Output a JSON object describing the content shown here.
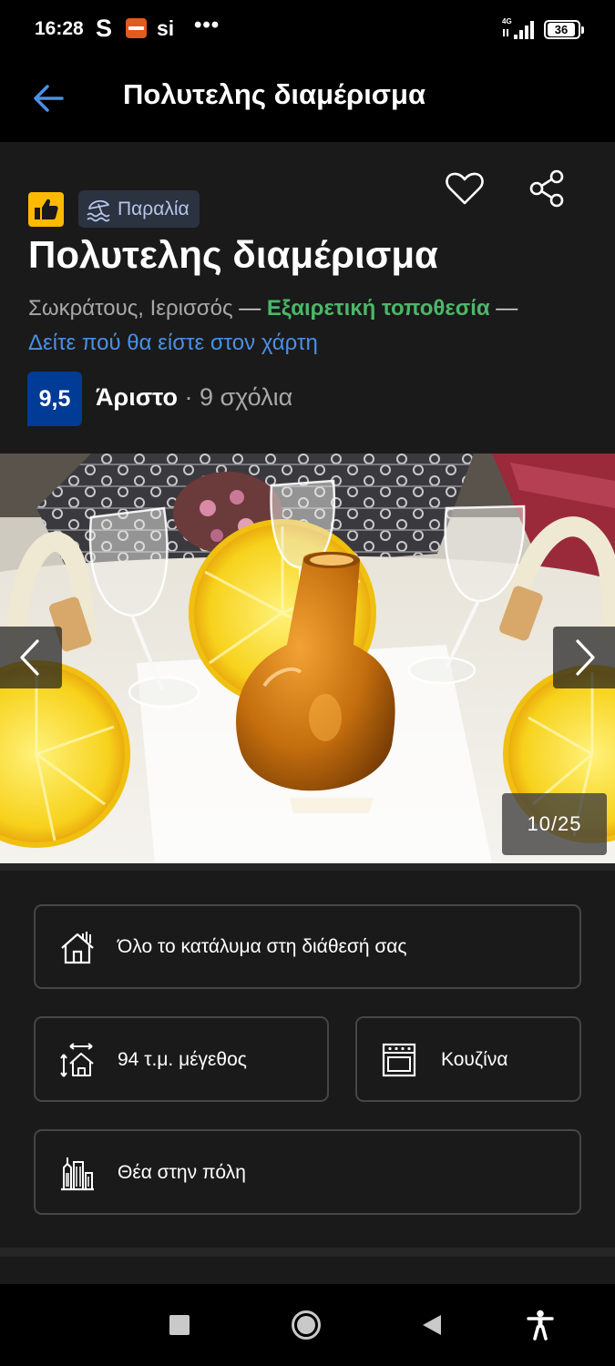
{
  "status_bar": {
    "time": "16:28",
    "s_icon": "S",
    "si_icon": "si",
    "more": "•••",
    "network": "4G",
    "battery": "36"
  },
  "app_bar": {
    "title": "Πολυτελης διαμέρισμα"
  },
  "property": {
    "tag": "Παραλία",
    "title": "Πολυτελης διαμέρισμα",
    "address": "Σωκράτους, Ιερισσός",
    "dash": "—",
    "location_rating": "Εξαιρετική τοποθεσία",
    "map_link": "Δείτε πού θα είστε στον χάρτη",
    "score": "9,5",
    "score_label": "Άριστο",
    "dot": "·",
    "reviews": "9 σχόλια"
  },
  "gallery": {
    "counter": "10/25",
    "current": 10,
    "total": 25
  },
  "facilities": [
    {
      "label": "Όλο το κατάλυμα στη διάθεσή σας",
      "icon": "house-icon"
    },
    {
      "label": "94 τ.μ. μέγεθος",
      "icon": "room-size-icon"
    },
    {
      "label": "Κουζίνα",
      "icon": "kitchen-icon"
    },
    {
      "label": "Θέα στην πόλη",
      "icon": "city-view-icon"
    }
  ],
  "colors": {
    "background": "#1a1a1a",
    "score_blue": "#003b95",
    "green": "#4cb769",
    "link_blue": "#4a90e6",
    "genius_yellow": "#feba02"
  }
}
